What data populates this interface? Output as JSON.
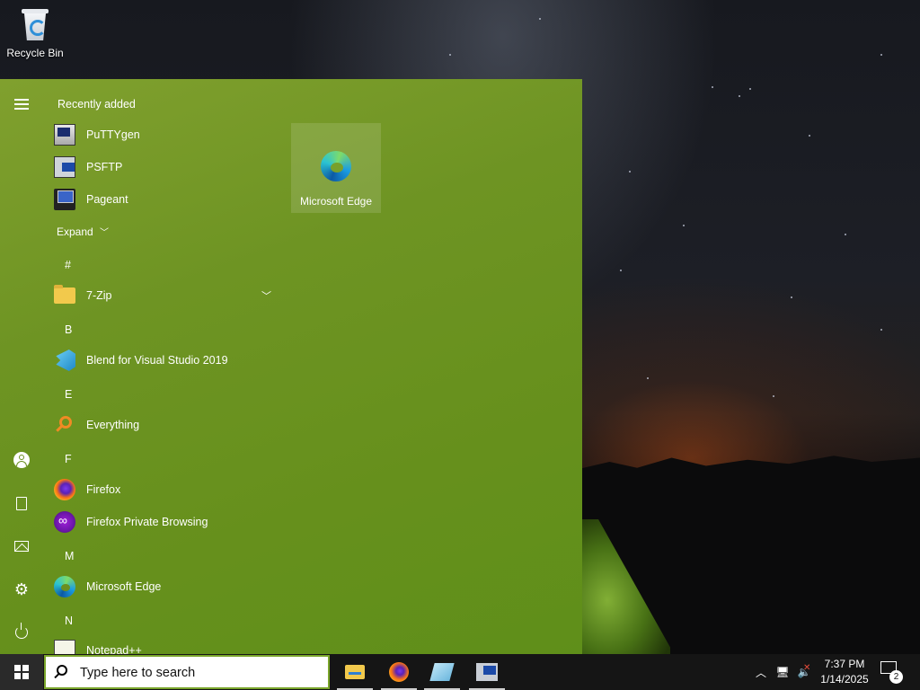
{
  "desktop": {
    "icons": [
      {
        "label": "Recycle Bin",
        "icon": "recycle-bin-icon"
      }
    ]
  },
  "start_menu": {
    "rail": [
      "hamburger-icon",
      "user-icon",
      "documents-icon",
      "pictures-icon",
      "settings-icon",
      "power-icon"
    ],
    "recently_added_label": "Recently added",
    "recent": [
      {
        "label": "PuTTYgen",
        "icon": "puttygen-icon"
      },
      {
        "label": "PSFTP",
        "icon": "psftp-icon"
      },
      {
        "label": "Pageant",
        "icon": "pageant-icon"
      }
    ],
    "expand_label": "Expand",
    "groups": [
      {
        "letter": "#",
        "items": [
          {
            "label": "7-Zip",
            "icon": "folder-icon",
            "expandable": true
          }
        ]
      },
      {
        "letter": "B",
        "items": [
          {
            "label": "Blend for Visual Studio 2019",
            "icon": "blend-icon"
          }
        ]
      },
      {
        "letter": "E",
        "items": [
          {
            "label": "Everything",
            "icon": "everything-icon"
          }
        ]
      },
      {
        "letter": "F",
        "items": [
          {
            "label": "Firefox",
            "icon": "firefox-icon"
          },
          {
            "label": "Firefox Private Browsing",
            "icon": "firefox-private-icon"
          }
        ]
      },
      {
        "letter": "M",
        "items": [
          {
            "label": "Microsoft Edge",
            "icon": "edge-icon"
          }
        ]
      },
      {
        "letter": "N",
        "items": [
          {
            "label": "Notepad++",
            "icon": "notepad-icon"
          }
        ]
      }
    ],
    "tiles": [
      {
        "label": "Microsoft Edge",
        "icon": "edge-icon"
      }
    ]
  },
  "taskbar": {
    "search_placeholder": "Type here to search",
    "apps": [
      "file-explorer-icon",
      "firefox-icon",
      "blend-icon",
      "putty-icon"
    ],
    "tray": {
      "time": "7:37 PM",
      "date": "1/14/2025",
      "notification_count": "2"
    }
  },
  "colors": {
    "accent": "#6e9423",
    "taskbar": "#151515",
    "search_border": "#7aa52a"
  }
}
